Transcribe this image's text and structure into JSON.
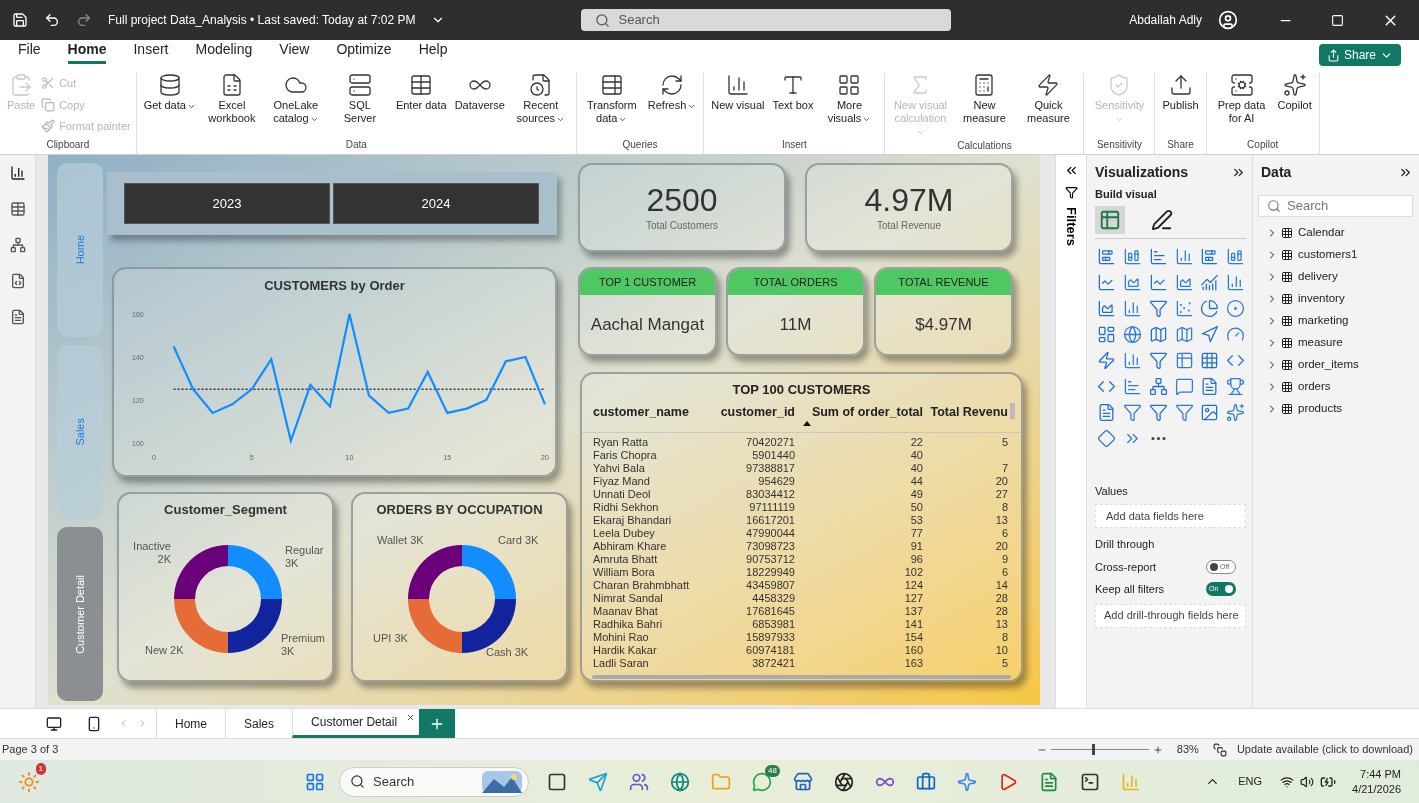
{
  "title_bar": {
    "title": "Full project Data_Analysis • Last saved: Today at 7:02 PM",
    "search_placeholder": "Search",
    "user": "Abdallah Adly"
  },
  "menu_tabs": [
    {
      "label": "File",
      "selected": false
    },
    {
      "label": "Home",
      "selected": true
    },
    {
      "label": "Insert",
      "selected": false
    },
    {
      "label": "Modeling",
      "selected": false
    },
    {
      "label": "View",
      "selected": false
    },
    {
      "label": "Optimize",
      "selected": false
    },
    {
      "label": "Help",
      "selected": false
    }
  ],
  "share_button": "Share",
  "ribbon": [
    {
      "label": "Clipboard",
      "buttons": [
        {
          "label": "Paste",
          "kind": "large",
          "dropdown": false,
          "disabled": true
        },
        {
          "label": "Cut",
          "kind": "small",
          "dropdown": false,
          "disabled": true
        },
        {
          "label": "Copy",
          "kind": "small",
          "dropdown": false,
          "disabled": true
        },
        {
          "label": "Format painter",
          "kind": "small",
          "dropdown": false,
          "disabled": true
        }
      ]
    },
    {
      "label": "Data",
      "buttons": [
        {
          "label": "Get data",
          "kind": "large",
          "dropdown": true,
          "disabled": false
        },
        {
          "label": "Excel workbook",
          "kind": "large",
          "dropdown": false,
          "disabled": false
        },
        {
          "label": "OneLake catalog",
          "kind": "large",
          "dropdown": true,
          "disabled": false
        },
        {
          "label": "SQL Server",
          "kind": "large",
          "dropdown": false,
          "disabled": false
        },
        {
          "label": "Enter data",
          "kind": "large",
          "dropdown": false,
          "disabled": false
        },
        {
          "label": "Dataverse",
          "kind": "large",
          "dropdown": false,
          "disabled": false
        },
        {
          "label": "Recent sources",
          "kind": "large",
          "dropdown": true,
          "disabled": false
        }
      ]
    },
    {
      "label": "Queries",
      "buttons": [
        {
          "label": "Transform data",
          "kind": "large",
          "dropdown": true,
          "disabled": false
        },
        {
          "label": "Refresh",
          "kind": "large",
          "dropdown": true,
          "disabled": false
        }
      ]
    },
    {
      "label": "Insert",
      "buttons": [
        {
          "label": "New visual",
          "kind": "large",
          "dropdown": false,
          "disabled": false
        },
        {
          "label": "Text box",
          "kind": "large",
          "dropdown": false,
          "disabled": false
        },
        {
          "label": "More visuals",
          "kind": "large",
          "dropdown": true,
          "disabled": false
        }
      ]
    },
    {
      "label": "Calculations",
      "buttons": [
        {
          "label": "New visual calculation",
          "kind": "large",
          "dropdown": true,
          "disabled": true
        },
        {
          "label": "New measure",
          "kind": "large",
          "dropdown": false,
          "disabled": false
        },
        {
          "label": "Quick measure",
          "kind": "large",
          "dropdown": false,
          "disabled": false
        }
      ]
    },
    {
      "label": "Sensitivity",
      "buttons": [
        {
          "label": "Sensitivity",
          "kind": "large",
          "dropdown": true,
          "disabled": true
        }
      ]
    },
    {
      "label": "Share",
      "buttons": [
        {
          "label": "Publish",
          "kind": "large",
          "dropdown": false,
          "disabled": false
        }
      ]
    },
    {
      "label": "Copilot",
      "buttons": [
        {
          "label": "Prep data for AI",
          "kind": "large",
          "dropdown": false,
          "disabled": false
        },
        {
          "label": "Copilot",
          "kind": "large",
          "dropdown": false,
          "disabled": false
        }
      ]
    }
  ],
  "report": {
    "nav": [
      {
        "label": "Home",
        "selected": false
      },
      {
        "label": "Sales",
        "selected": false
      },
      {
        "label": "Customer Detail",
        "selected": true
      }
    ],
    "year_slicer": [
      "2023",
      "2024"
    ],
    "kpi_cards": [
      {
        "value": "2500",
        "label": "Total Customers"
      },
      {
        "value": "4.97M",
        "label": "Total Revenue"
      }
    ],
    "header_cards": [
      {
        "title": "TOP 1 CUSTOMER",
        "value": "Aachal Mangat"
      },
      {
        "title": "TOTAL ORDERS",
        "value": "11M"
      },
      {
        "title": "TOTAL REVENUE",
        "value": "$4.97M"
      }
    ],
    "line_chart": {
      "title": "CUSTOMERS by Order",
      "chart_data": {
        "type": "line",
        "x": [
          1,
          2,
          3,
          4,
          5,
          6,
          7,
          8,
          9,
          10,
          11,
          12,
          13,
          14,
          15,
          16,
          17,
          18,
          19,
          20
        ],
        "series": [
          {
            "color": "#118dff",
            "values": [
              145,
              125,
              114,
              118,
              125,
              139,
              101,
              127,
              117,
              160,
              122,
              114,
              116,
              133,
              114,
              116,
              120,
              138,
              140,
              118
            ]
          }
        ],
        "xlim": [
          0,
          20
        ],
        "ylim": [
          100,
          160
        ],
        "xticks": [
          0,
          5,
          10,
          15,
          20
        ],
        "yticks": [
          100,
          120,
          140,
          160
        ],
        "ref_lines": [
          {
            "axis": "y",
            "value": 125
          }
        ]
      }
    },
    "segment_chart": {
      "title": "Customer_Segment",
      "slices": [
        {
          "label": "Inactive 2K",
          "color": "#6b007b"
        },
        {
          "label": "Regular 3K",
          "color": "#118dff"
        },
        {
          "label": "New 2K",
          "color": "#e66c37"
        },
        {
          "label": "Premium 3K",
          "color": "#12239e"
        }
      ]
    },
    "occupation_chart": {
      "title": "ORDERS BY OCCUPATION",
      "slices": [
        {
          "label": "Wallet 3K",
          "color": "#6b007b"
        },
        {
          "label": "Card 3K",
          "color": "#118dff"
        },
        {
          "label": "Cash 3K",
          "color": "#12239e"
        },
        {
          "label": "UPI 3K",
          "color": "#e66c37"
        }
      ]
    },
    "table": {
      "title": "TOP 100 CUSTOMERS",
      "columns": [
        {
          "label": "customer_name",
          "sorted": false
        },
        {
          "label": "customer_id",
          "sorted": false
        },
        {
          "label": "Sum of order_total",
          "sorted": true
        },
        {
          "label": "Total Revenu",
          "sorted": false
        }
      ],
      "rows": [
        [
          "Ryan Ratta",
          "70420271",
          "22",
          "5"
        ],
        [
          "Faris Chopra",
          "5901440",
          "40"
        ],
        [
          "Yahvi Bala",
          "97388817",
          "40",
          "7"
        ],
        [
          "Fiyaz Mand",
          "954629",
          "44",
          "20"
        ],
        [
          "Unnati Deol",
          "83034412",
          "49",
          "27"
        ],
        [
          "Ridhi Sekhon",
          "97111119",
          "50",
          "8"
        ],
        [
          "Ekaraj Bhandari",
          "16617201",
          "53",
          "13"
        ],
        [
          "Leela Dubey",
          "47990044",
          "77",
          "6"
        ],
        [
          "Abhiram Khare",
          "73098723",
          "91",
          "20"
        ],
        [
          "Amruta Bhatt",
          "90753712",
          "96",
          "9"
        ],
        [
          "William Bora",
          "18229949",
          "102",
          "6"
        ],
        [
          "Charan Brahmbhatt",
          "43459807",
          "124",
          "14"
        ],
        [
          "Nimrat Sandal",
          "4458329",
          "127",
          "28"
        ],
        [
          "Maanav Bhat",
          "17681645",
          "137",
          "28"
        ],
        [
          "Radhika Bahri",
          "6853981",
          "141",
          "13"
        ],
        [
          "Mohini Rao",
          "15897933",
          "154",
          "8"
        ],
        [
          "Hardik Kakar",
          "60974181",
          "160",
          "10"
        ],
        [
          "Ladli Saran",
          "3872421",
          "163",
          "5"
        ]
      ]
    }
  },
  "filters_pane": {
    "label": "Filters"
  },
  "visualizations": {
    "title": "Visualizations",
    "subtitle": "Build visual",
    "tabs": [
      {
        "selected": true
      },
      {
        "selected": false
      }
    ],
    "values_label": "Values",
    "values_placeholder": "Add data fields here",
    "drill_label": "Drill through",
    "toggles": [
      {
        "label": "Cross-report",
        "on": false,
        "text": "Off"
      },
      {
        "label": "Keep all filters",
        "on": true,
        "text": "On"
      }
    ],
    "drill_placeholder": "Add drill-through fields here"
  },
  "data_pane": {
    "title": "Data",
    "search_placeholder": "Search",
    "tables": [
      {
        "name": "Calendar",
        "expanded": false
      },
      {
        "name": "customers1",
        "expanded": false
      },
      {
        "name": "delivery",
        "expanded": false
      },
      {
        "name": "inventory",
        "expanded": false
      },
      {
        "name": "marketing",
        "expanded": false
      },
      {
        "name": "measure",
        "expanded": false
      },
      {
        "name": "order_items",
        "expanded": false
      },
      {
        "name": "orders",
        "expanded": false
      },
      {
        "name": "products",
        "expanded": false
      }
    ]
  },
  "page_tabs": [
    {
      "label": "Home",
      "selected": false
    },
    {
      "label": "Sales",
      "selected": false
    },
    {
      "label": "Customer Detail",
      "selected": true
    }
  ],
  "status_bar": {
    "page": "Page 3 of 3",
    "zoom": {
      "level": 0.42,
      "reading": "83%"
    },
    "update": "Update available (click to download)"
  },
  "taskbar": {
    "search_placeholder": "Search",
    "widget_badge": "1",
    "chat_badge": "48",
    "language": "ENG",
    "time": "7:44 PM",
    "date": "4/21/2026"
  }
}
